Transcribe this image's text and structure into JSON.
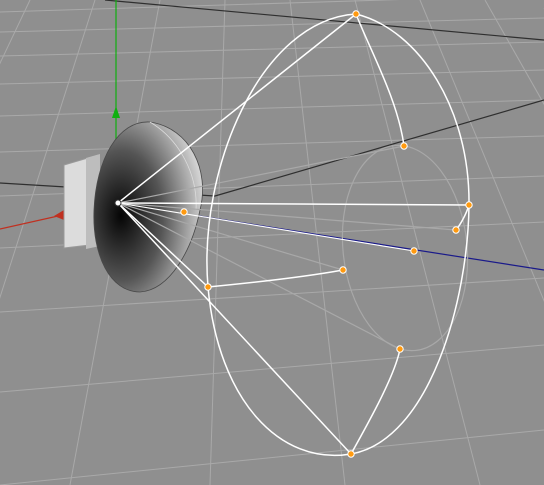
{
  "viewport": {
    "view": "perspective",
    "background_color": "#8f8f8f",
    "grid_color": "#a9a9a9",
    "horizon_line_color": "#2f2f2f"
  },
  "axes": {
    "x_axis_color": "#c03020",
    "y_axis_color": "#10b010",
    "z_axis_color": "#1a1a8a"
  },
  "spotlight": {
    "cone_color": "#ffffff",
    "inner_cone_color": "#a8a8a8",
    "handle_color": "#ff9a10",
    "icons": [
      "spotlight-housing",
      "lamp-body",
      "light-cone",
      "falloff-ring",
      "axis-gizmo",
      "cone-handle"
    ]
  }
}
